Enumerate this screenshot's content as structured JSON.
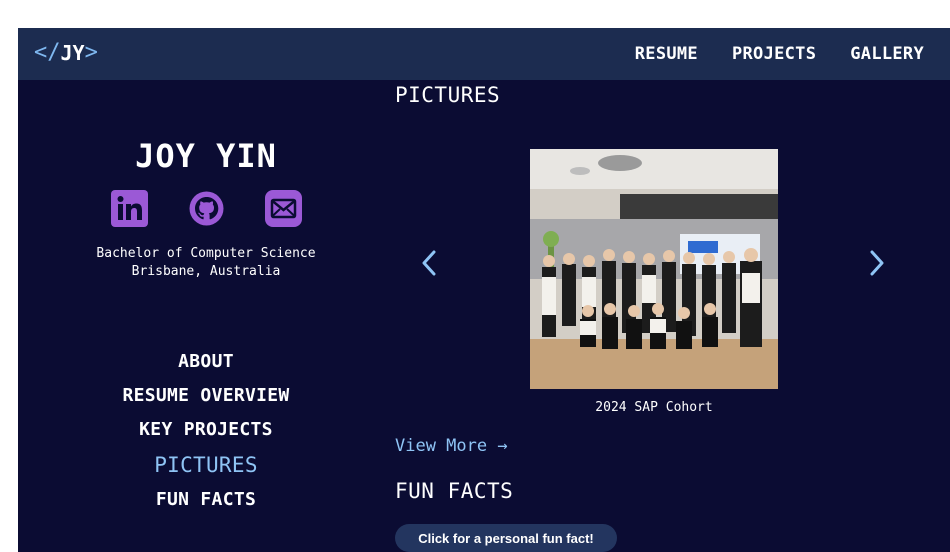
{
  "nav": {
    "logo_open": "</",
    "logo_text": "JY",
    "logo_close": ">",
    "links": [
      {
        "label": "RESUME"
      },
      {
        "label": "PROJECTS"
      },
      {
        "label": "GALLERY"
      }
    ]
  },
  "profile": {
    "name": "JOY YIN",
    "degree": "Bachelor of Computer Science",
    "location": "Brisbane, Australia",
    "socials": [
      {
        "icon": "linkedin-icon"
      },
      {
        "icon": "github-icon"
      },
      {
        "icon": "email-icon"
      }
    ]
  },
  "sidebar": {
    "items": [
      {
        "label": "ABOUT",
        "active": false
      },
      {
        "label": "RESUME OVERVIEW",
        "active": false
      },
      {
        "label": "KEY PROJECTS",
        "active": false
      },
      {
        "label": "PICTURES",
        "active": true
      },
      {
        "label": "FUN FACTS",
        "active": false
      }
    ]
  },
  "pictures": {
    "title": "PICTURES",
    "caption": "2024 SAP Cohort",
    "view_more": "View More →"
  },
  "fun_facts": {
    "title": "FUN FACTS",
    "button_label": "Click for a personal fun fact!"
  },
  "colors": {
    "background": "#0b0c33",
    "navbar": "#1c2c50",
    "accent": "#8fc4f5",
    "icon_purple": "#9b59d6"
  }
}
